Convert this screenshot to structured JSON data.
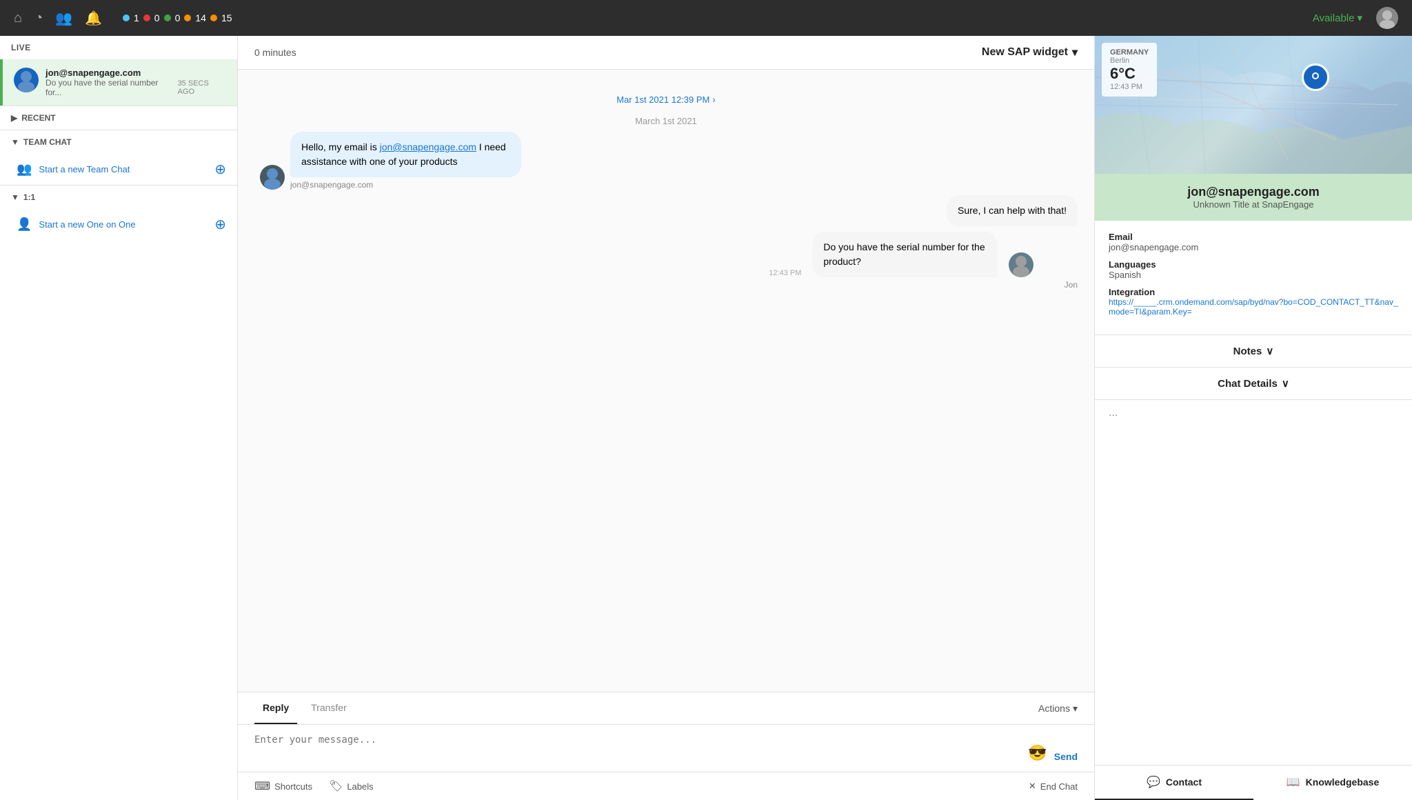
{
  "topnav": {
    "home_icon": "⌂",
    "clock_icon": "○",
    "people_icon": "⚇",
    "bell_icon": "♪",
    "status_indicators": [
      {
        "color": "blue",
        "count": "1"
      },
      {
        "color": "red",
        "count": "0"
      },
      {
        "color": "green",
        "count": "0"
      },
      {
        "color": "orange",
        "count": "14"
      },
      {
        "color": "orange2",
        "count": "15"
      }
    ],
    "available_label": "Available",
    "available_arrow": "▾"
  },
  "sidebar": {
    "live_label": "LIVE",
    "live_user_email": "jon@snapengage.com",
    "live_user_preview": "Do you have the serial number for...",
    "live_user_time": "35 SECS AGO",
    "recent_label": "RECENT",
    "team_chat_label": "TEAM CHAT",
    "start_team_chat_label": "Start a new Team Chat",
    "one_on_one_label": "1:1",
    "start_one_on_one_label": "Start a new One on One"
  },
  "chat": {
    "time_label": "0 minutes",
    "widget_label": "New SAP widget",
    "widget_arrow": "▾",
    "date_link": "Mar 1st 2021 12:39 PM",
    "date_separator": "March 1st 2021",
    "messages": [
      {
        "id": "msg1",
        "side": "left",
        "text_prefix": "Hello, my email is ",
        "email_link": "jon@snapengage.com",
        "text_suffix": " I need assistance with one of your products",
        "sender": "jon@snapengage.com"
      },
      {
        "id": "msg2",
        "side": "right",
        "text": "Sure, I can help with that!"
      },
      {
        "id": "msg3",
        "side": "right",
        "text": "Do you have the serial number for the product?",
        "time": "12:43 PM",
        "agent_name": "Jon"
      }
    ],
    "reply_tab_label": "Reply",
    "transfer_tab_label": "Transfer",
    "actions_label": "Actions",
    "actions_arrow": "▾",
    "input_placeholder": "Enter your message...",
    "send_label": "Send",
    "shortcuts_label": "Shortcuts",
    "labels_label": "Labels",
    "end_chat_label": "End Chat"
  },
  "right_panel": {
    "weather": {
      "country": "GERMANY",
      "city": "Berlin",
      "temp": "6°C",
      "time": "12:43 PM"
    },
    "user_email": "jon@snapengage.com",
    "user_title": "Unknown Title at SnapEngage",
    "email_label": "Email",
    "email_value": "jon@snapengage.com",
    "languages_label": "Languages",
    "languages_value": "Spanish",
    "integration_label": "Integration",
    "integration_link": "https://_____.crm.ondemand.com/sap/byd/nav?bo=COD_CONTACT_TT&nav_mode=TI&param.Key=",
    "notes_label": "Notes",
    "notes_arrow": "∨",
    "chat_details_label": "Chat Details",
    "chat_details_arrow": "∨",
    "ellipsis": "...",
    "contact_tab_label": "Contact",
    "knowledgebase_tab_label": "Knowledgebase"
  }
}
